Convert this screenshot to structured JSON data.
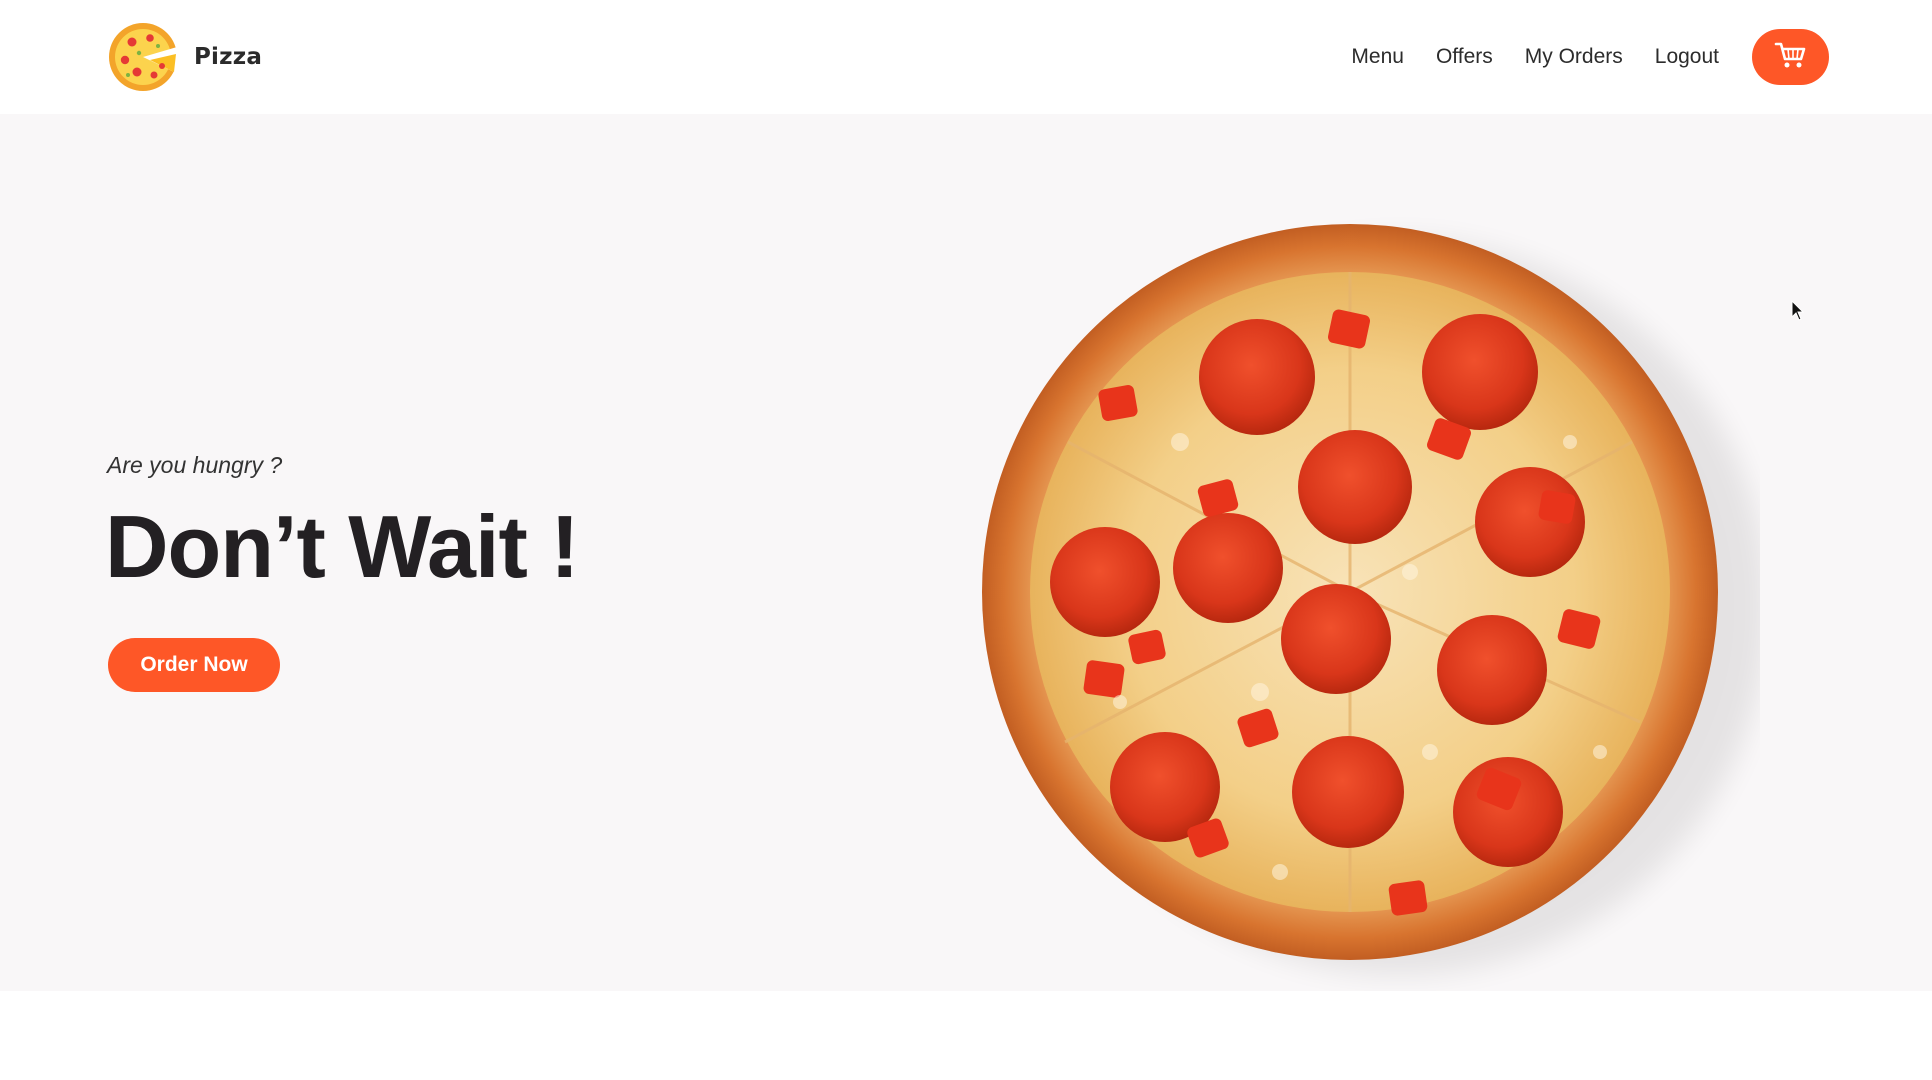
{
  "brand": {
    "name": "Pizza",
    "logo_icon": "pizza-slice-logo"
  },
  "nav": {
    "items": [
      {
        "label": "Menu"
      },
      {
        "label": "Offers"
      },
      {
        "label": "My Orders"
      },
      {
        "label": "Logout"
      }
    ],
    "cart_icon": "cart-icon"
  },
  "hero": {
    "tagline": "Are you hungry ?",
    "headline": "Don’t Wait !",
    "cta_label": "Order Now",
    "image_subject": "pepperoni-pizza"
  },
  "colors": {
    "accent": "#fe5727",
    "hero_background": "#f9f7f8",
    "header_background": "#ffffff",
    "headline_text": "#232023"
  }
}
